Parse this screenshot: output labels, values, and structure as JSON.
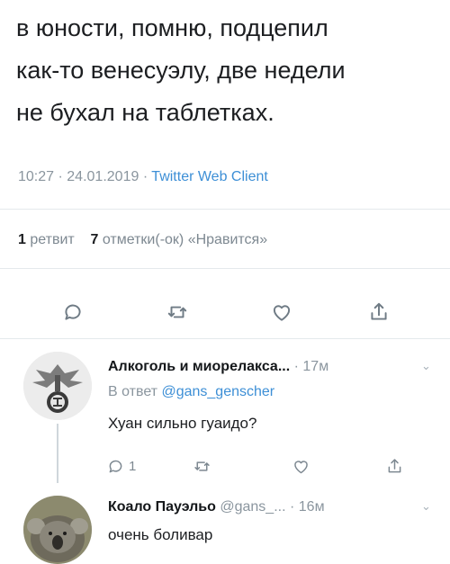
{
  "tweet": {
    "lines": [
      "в юности, помню, подцепил",
      "как-то венесуэлу, две недели",
      "не бухал на таблетках."
    ],
    "time": "10:27",
    "date": "24.01.2019",
    "client": "Twitter Web Client",
    "retweets_count": "1",
    "retweets_label": "ретвит",
    "likes_count": "7",
    "likes_label": "отметки(-ок) «Нравится»"
  },
  "replies": [
    {
      "name": "Алкоголь и миорелакса...",
      "age": "17м",
      "reply_prefix": "В ответ",
      "reply_handle": "@gans_genscher",
      "text": "Хуан сильно гуаидо?",
      "reply_count": "1"
    },
    {
      "name": "Коало Пауэльо",
      "handle": "@gans_...",
      "age": "16м",
      "text": "очень боливар"
    }
  ],
  "colors": {
    "accent": "#3d8fd6",
    "muted": "#8a959e",
    "text": "#1c1e21"
  },
  "icons": [
    "reply-icon",
    "retweet-icon",
    "like-icon",
    "share-icon",
    "caret-down-icon"
  ]
}
